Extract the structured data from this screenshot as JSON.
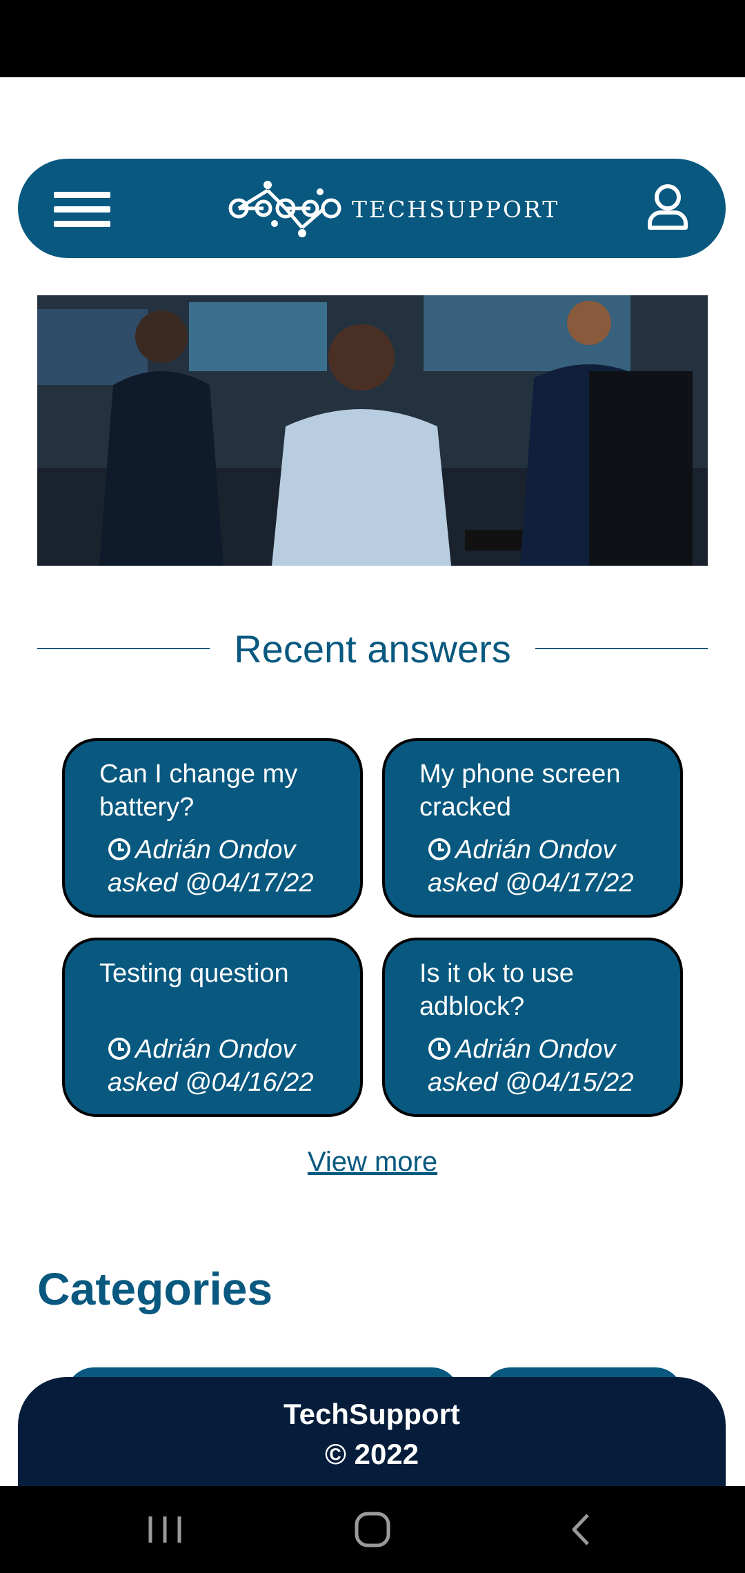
{
  "header": {
    "logo_text": "TECHSUPPORT",
    "icons": {
      "menu": "hamburger-menu-icon",
      "account": "user-account-icon",
      "logo": "network-nodes-logo"
    }
  },
  "hero": {
    "description_icon": "support-agents-photo"
  },
  "recent": {
    "title": "Recent answers",
    "cards": [
      {
        "question": "Can I change my battery?",
        "author": "Adrián Ondov",
        "asked": "asked @04/17/22"
      },
      {
        "question": "My phone screen cracked",
        "author": "Adrián Ondov",
        "asked": "asked @04/17/22"
      },
      {
        "question": "Testing question",
        "author": "Adrián Ondov",
        "asked": "asked @04/16/22"
      },
      {
        "question": "Is it ok to use adblock?",
        "author": "Adrián Ondov",
        "asked": "asked @04/15/22"
      }
    ],
    "view_more": "View more"
  },
  "categories": {
    "title": "Categories"
  },
  "footer": {
    "brand": "TechSupport",
    "copyright": "© 2022"
  },
  "colors": {
    "primary": "#08587f",
    "footer": "#051d3a",
    "background": "#ffffff"
  }
}
